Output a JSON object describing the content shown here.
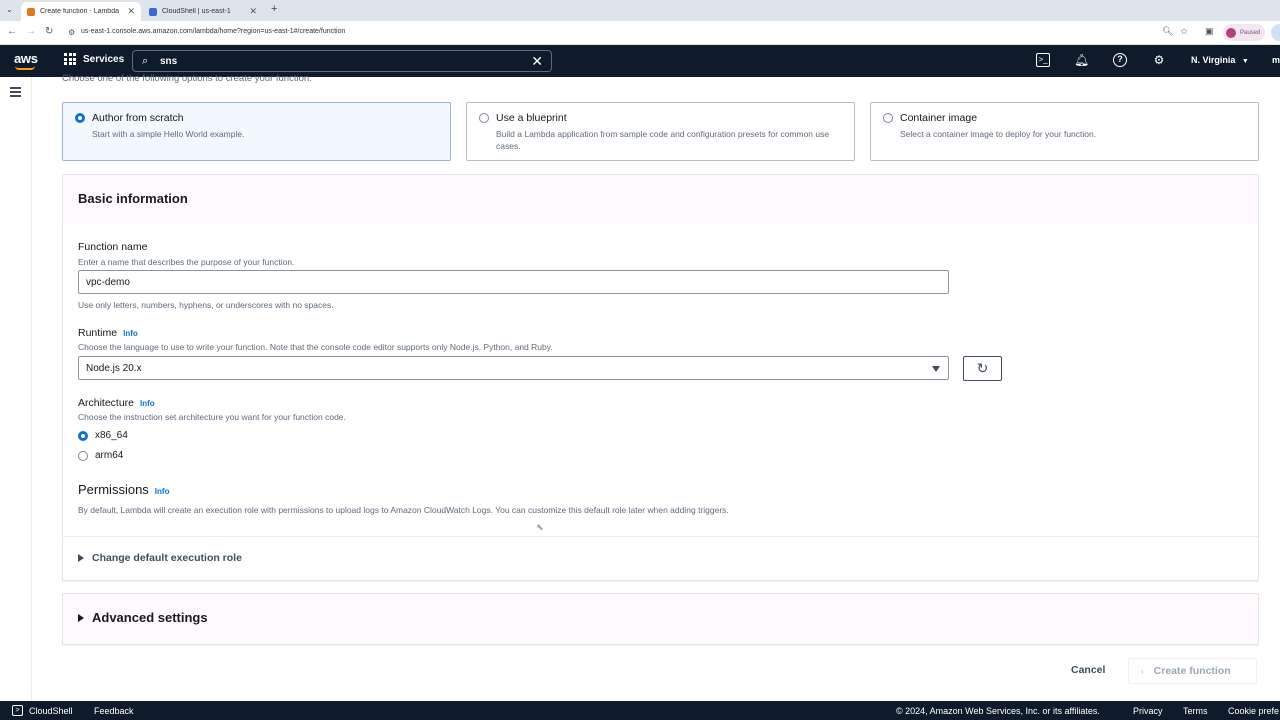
{
  "browser": {
    "tabs": [
      {
        "title": "Create function - Lambda",
        "favicon_color": "#e07a1f"
      },
      {
        "title": "CloudShell | us-east-1",
        "favicon_color": "#3b67d6"
      }
    ],
    "url": "us-east-1.console.aws.amazon.com/lambda/home?region=us-east-1#/create/function",
    "profile_status": "Paused"
  },
  "awsnav": {
    "logo": "aws",
    "services_label": "Services",
    "search_value": "sns",
    "region_label": "N. Virginia",
    "region_chevron": "▼",
    "overflow_label": "m"
  },
  "main": {
    "intro_text": "Choose one of the following options to create your function.",
    "options": [
      {
        "title": "Author from scratch",
        "desc": "Start with a simple Hello World example.",
        "selected": true
      },
      {
        "title": "Use a blueprint",
        "desc": "Build a Lambda application from sample code and configuration presets for common use cases.",
        "selected": false
      },
      {
        "title": "Container image",
        "desc": "Select a container image to deploy for your function.",
        "selected": false
      }
    ],
    "basic_info": {
      "title": "Basic information",
      "function_name": {
        "label": "Function name",
        "description": "Enter a name that describes the purpose of your function.",
        "value": "vpc-demo",
        "constraint": "Use only letters, numbers, hyphens, or underscores with no spaces."
      },
      "runtime": {
        "label": "Runtime",
        "info": "Info",
        "description": "Choose the language to use to write your function. Note that the console code editor supports only Node.js, Python, and Ruby.",
        "value": "Node.js 20.x"
      },
      "architecture": {
        "label": "Architecture",
        "info": "Info",
        "description": "Choose the instruction set architecture you want for your function code.",
        "options": [
          {
            "label": "x86_64",
            "selected": true
          },
          {
            "label": "arm64",
            "selected": false
          }
        ]
      },
      "permissions": {
        "title": "Permissions",
        "info": "Info",
        "description": "By default, Lambda will create an execution role with permissions to upload logs to Amazon CloudWatch Logs. You can customize this default role later when adding triggers.",
        "expander_label": "Change default execution role"
      }
    },
    "advanced_settings_label": "Advanced settings",
    "cancel_label": "Cancel",
    "create_label": "Create function"
  },
  "footer": {
    "cloudshell_label": "CloudShell",
    "feedback_label": "Feedback",
    "copyright": "© 2024, Amazon Web Services, Inc. or its affiliates.",
    "privacy_label": "Privacy",
    "terms_label": "Terms",
    "cookie_label": "Cookie prefe"
  },
  "colors": {
    "nav_bg": "#0f1b2a",
    "accent_blue": "#0972d3",
    "aws_orange": "#ff9900"
  }
}
